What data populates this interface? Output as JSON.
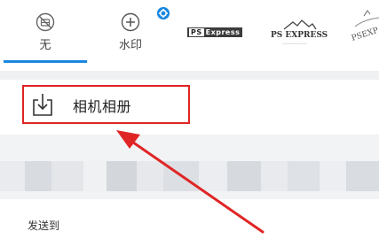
{
  "watermark_bar": {
    "options": [
      {
        "label": "无",
        "icon": "no-watermark-icon",
        "selected": true
      },
      {
        "label": "水印",
        "icon": "add-circle-icon",
        "selected": false,
        "badge_icon": "settings-badge-icon"
      },
      {
        "logo": "PS Express",
        "logo_icon": "ps-express-badge-logo"
      },
      {
        "logo": "PS EXPRESS",
        "logo_icon": "ps-express-mountain-logo"
      },
      {
        "logo": "PSEXP",
        "logo_icon": "ps-express-arc-logo"
      }
    ],
    "accent_color": "#1a87e0"
  },
  "save": {
    "label": "相机相册",
    "icon": "download-to-tray-icon",
    "highlight_color": "#e02525"
  },
  "share": {
    "title": "发送到"
  }
}
